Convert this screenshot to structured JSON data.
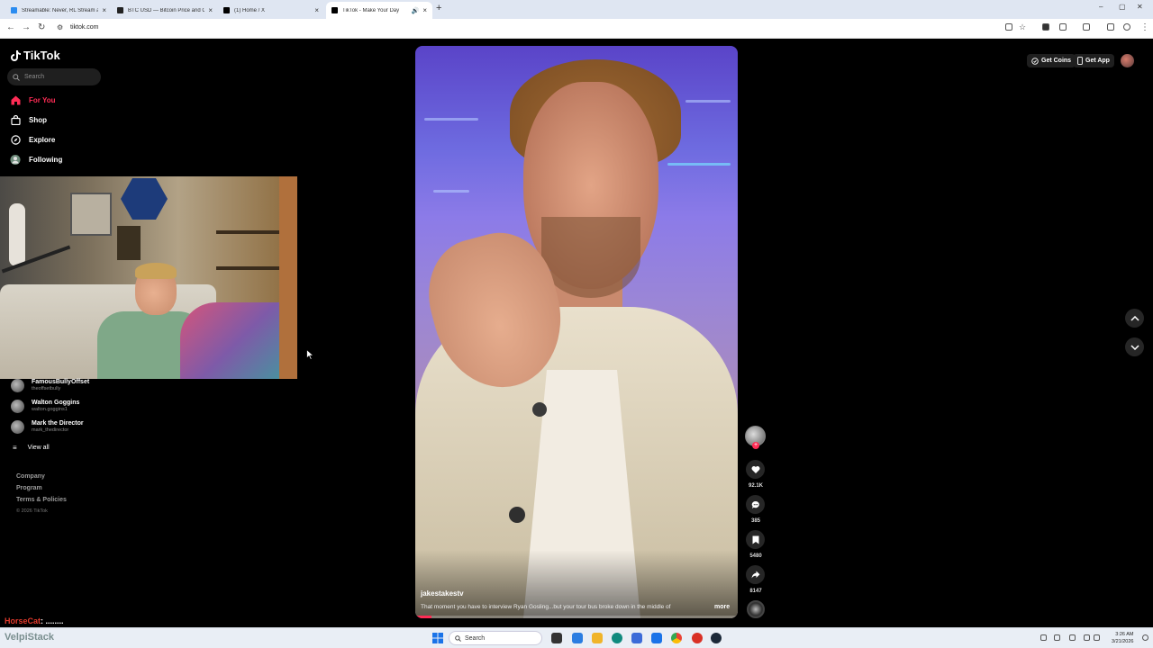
{
  "browser": {
    "tabs": [
      {
        "title": "Streamable: Never, RL Stream a",
        "active": false
      },
      {
        "title": "BTC USD — Bitcoin Price and C",
        "active": false
      },
      {
        "title": "(1) Home / X",
        "active": false
      },
      {
        "title": "TikTok - Make Your Day",
        "active": true
      }
    ],
    "url": "tiktok.com"
  },
  "sidebar": {
    "logo": "TikTok",
    "search_placeholder": "Search",
    "nav": [
      {
        "label": "For You",
        "icon": "home-icon",
        "active": true
      },
      {
        "label": "Shop",
        "icon": "shopping-bag-icon",
        "active": false
      },
      {
        "label": "Explore",
        "icon": "compass-icon",
        "active": false
      },
      {
        "label": "Following",
        "icon": "following-icon",
        "active": false
      }
    ],
    "following": [
      {
        "name": "FamousBullyOffset",
        "handle": "theoffsetbully"
      },
      {
        "name": "Walton Goggins",
        "handle": "walton.goggins1"
      },
      {
        "name": "Mark the Director",
        "handle": "mark_thedirector"
      }
    ],
    "view_all": "View all",
    "footer": {
      "company": "Company",
      "program": "Program",
      "terms": "Terms & Policies",
      "copyright": "© 2026 TikTok"
    }
  },
  "video": {
    "author": "jakestakestv",
    "caption": "That moment you have to interview Ryan Gosling...but your tour bus broke down in the middle of",
    "more": "more",
    "progress": 0.05
  },
  "actions": {
    "likes": "92.1K",
    "comments": "385",
    "saves": "5480",
    "shares": "8147"
  },
  "topbar": {
    "get_coins": "Get Coins",
    "get_app": "Get App"
  },
  "overlay": {
    "chat_user": "HorseCat",
    "chat_message": ": ........"
  },
  "taskbar": {
    "brand": "VelpiStack",
    "search_placeholder": "Search",
    "time": "3:26 AM",
    "date": "3/21/2026"
  },
  "colors": {
    "accent": "#fe2c55",
    "background": "#000000"
  }
}
